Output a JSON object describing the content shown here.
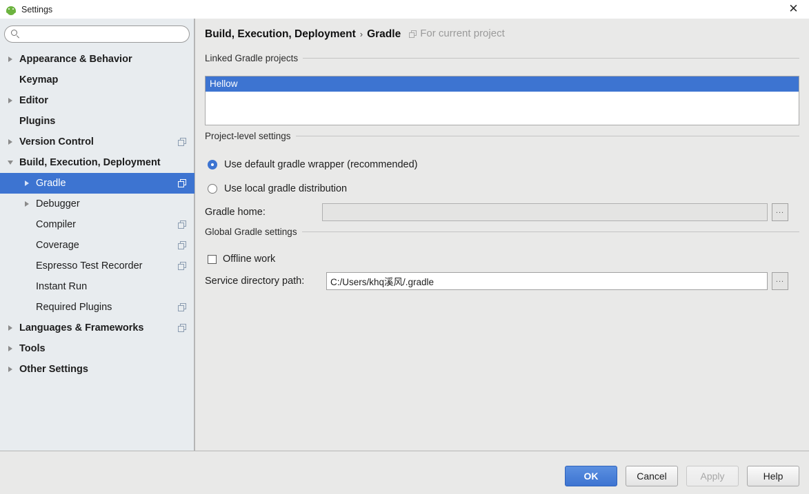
{
  "window": {
    "title": "Settings",
    "icon": "android-icon",
    "close_label": "✕"
  },
  "sidebar": {
    "search": {
      "value": "",
      "placeholder": "",
      "icon": "search-icon"
    },
    "items": [
      {
        "label": "Appearance & Behavior",
        "level": 0,
        "arrow": "right",
        "bold": true,
        "selected": false,
        "module_icon": false
      },
      {
        "label": "Keymap",
        "level": 0,
        "arrow": "none",
        "bold": true,
        "selected": false,
        "module_icon": false
      },
      {
        "label": "Editor",
        "level": 0,
        "arrow": "right",
        "bold": true,
        "selected": false,
        "module_icon": false
      },
      {
        "label": "Plugins",
        "level": 0,
        "arrow": "none",
        "bold": true,
        "selected": false,
        "module_icon": false
      },
      {
        "label": "Version Control",
        "level": 0,
        "arrow": "right",
        "bold": true,
        "selected": false,
        "module_icon": true
      },
      {
        "label": "Build, Execution, Deployment",
        "level": 0,
        "arrow": "down",
        "bold": true,
        "selected": false,
        "module_icon": false
      },
      {
        "label": "Gradle",
        "level": 1,
        "arrow": "right",
        "bold": false,
        "selected": true,
        "module_icon": true
      },
      {
        "label": "Debugger",
        "level": 1,
        "arrow": "right",
        "bold": false,
        "selected": false,
        "module_icon": false
      },
      {
        "label": "Compiler",
        "level": 1,
        "arrow": "none",
        "bold": false,
        "selected": false,
        "module_icon": true
      },
      {
        "label": "Coverage",
        "level": 1,
        "arrow": "none",
        "bold": false,
        "selected": false,
        "module_icon": true
      },
      {
        "label": "Espresso Test Recorder",
        "level": 1,
        "arrow": "none",
        "bold": false,
        "selected": false,
        "module_icon": true
      },
      {
        "label": "Instant Run",
        "level": 1,
        "arrow": "none",
        "bold": false,
        "selected": false,
        "module_icon": false
      },
      {
        "label": "Required Plugins",
        "level": 1,
        "arrow": "none",
        "bold": false,
        "selected": false,
        "module_icon": true
      },
      {
        "label": "Languages & Frameworks",
        "level": 0,
        "arrow": "right",
        "bold": true,
        "selected": false,
        "module_icon": true
      },
      {
        "label": "Tools",
        "level": 0,
        "arrow": "right",
        "bold": true,
        "selected": false,
        "module_icon": false
      },
      {
        "label": "Other Settings",
        "level": 0,
        "arrow": "right",
        "bold": true,
        "selected": false,
        "module_icon": false
      }
    ]
  },
  "main": {
    "breadcrumb": {
      "parent": "Build, Execution, Deployment",
      "separator": "›",
      "current": "Gradle",
      "scope_note": "For current project",
      "scope_icon": "module-icon"
    },
    "linked_projects": {
      "group_title": "Linked Gradle projects",
      "items": [
        {
          "label": "Hellow",
          "selected": true
        }
      ]
    },
    "project_level": {
      "group_title": "Project-level settings",
      "radios": [
        {
          "label": "Use default gradle wrapper (recommended)",
          "checked": true
        },
        {
          "label": "Use local gradle distribution",
          "checked": false
        }
      ],
      "gradle_home": {
        "label": "Gradle home:",
        "value": "",
        "placeholder": "",
        "disabled": true,
        "browse_label": "..."
      }
    },
    "global_settings": {
      "group_title": "Global Gradle settings",
      "offline_work": {
        "label": "Offline work",
        "checked": false
      },
      "service_directory": {
        "label": "Service directory path:",
        "value": "C:/Users/khq溪风/.gradle",
        "placeholder": "",
        "browse_label": "..."
      }
    }
  },
  "footer": {
    "buttons": [
      {
        "label": "OK",
        "style": "primary"
      },
      {
        "label": "Cancel",
        "style": "normal"
      },
      {
        "label": "Apply",
        "style": "disabled"
      },
      {
        "label": "Help",
        "style": "normal"
      }
    ]
  },
  "colors": {
    "accent": "#3d74d1",
    "sidebar_bg": "#e8ecef",
    "panel_bg": "#e9e9e8",
    "android_green": "#6cb33f"
  }
}
